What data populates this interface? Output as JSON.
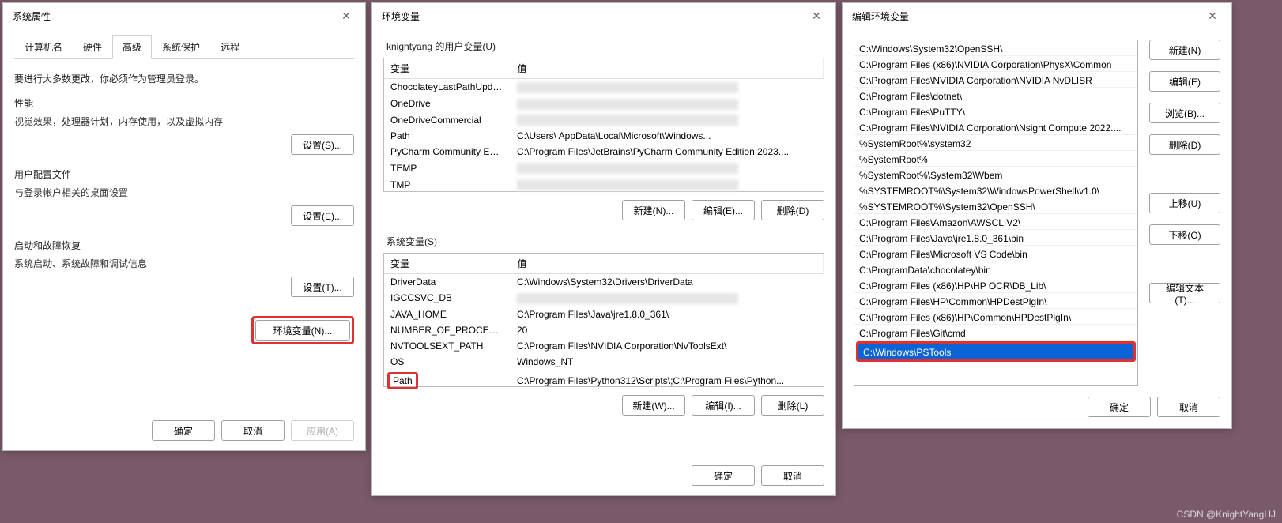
{
  "dlg1": {
    "title": "系统属性",
    "tabs": [
      "计算机名",
      "硬件",
      "高级",
      "系统保护",
      "远程"
    ],
    "activeTab": 2,
    "note": "要进行大多数更改，你必须作为管理员登录。",
    "groups": [
      {
        "title": "性能",
        "desc": "视觉效果，处理器计划，内存使用，以及虚拟内存",
        "btn": "设置(S)..."
      },
      {
        "title": "用户配置文件",
        "desc": "与登录帐户相关的桌面设置",
        "btn": "设置(E)..."
      },
      {
        "title": "启动和故障恢复",
        "desc": "系统启动、系统故障和调试信息",
        "btn": "设置(T)..."
      }
    ],
    "envBtn": "环境变量(N)...",
    "ok": "确定",
    "cancel": "取消",
    "apply": "应用(A)"
  },
  "dlg2": {
    "title": "环境变量",
    "userSection": "knightyang 的用户变量(U)",
    "sysSection": "系统变量(S)",
    "colVar": "变量",
    "colVal": "值",
    "userRows": [
      {
        "var": "ChocolateyLastPathUpdate",
        "val": "",
        "blur": true
      },
      {
        "var": "OneDrive",
        "val": "",
        "blur": true
      },
      {
        "var": "OneDriveCommercial",
        "val": "",
        "blur": true
      },
      {
        "var": "Path",
        "val": "C:\\Users\\                      AppData\\Local\\Microsoft\\Windows..."
      },
      {
        "var": "PyCharm Community Editi...",
        "val": "C:\\Program Files\\JetBrains\\PyCharm Community Edition 2023...."
      },
      {
        "var": "TEMP",
        "val": "",
        "blur": true
      },
      {
        "var": "TMP",
        "val": "",
        "blur": true
      }
    ],
    "sysRows": [
      {
        "var": "DriverData",
        "val": "C:\\Windows\\System32\\Drivers\\DriverData"
      },
      {
        "var": "IGCCSVC_DB",
        "val": "",
        "blur": true
      },
      {
        "var": "JAVA_HOME",
        "val": "C:\\Program Files\\Java\\jre1.8.0_361\\"
      },
      {
        "var": "NUMBER_OF_PROCESSORS",
        "val": "20"
      },
      {
        "var": "NVTOOLSEXT_PATH",
        "val": "C:\\Program Files\\NVIDIA Corporation\\NvToolsExt\\"
      },
      {
        "var": "OS",
        "val": "Windows_NT"
      },
      {
        "var": "Path",
        "val": "C:\\Program Files\\Python312\\Scripts\\;C:\\Program Files\\Python...",
        "hl": true
      }
    ],
    "newU": "新建(N)...",
    "editU": "编辑(E)...",
    "delU": "删除(D)",
    "newS": "新建(W)...",
    "editS": "编辑(I)...",
    "delS": "删除(L)",
    "ok": "确定",
    "cancel": "取消"
  },
  "dlg3": {
    "title": "编辑环境变量",
    "items": [
      "C:\\Windows\\System32\\OpenSSH\\",
      "C:\\Program Files (x86)\\NVIDIA Corporation\\PhysX\\Common",
      "C:\\Program Files\\NVIDIA Corporation\\NVIDIA NvDLISR",
      "C:\\Program Files\\dotnet\\",
      "C:\\Program Files\\PuTTY\\",
      "C:\\Program Files\\NVIDIA Corporation\\Nsight Compute 2022....",
      "%SystemRoot%\\system32",
      "%SystemRoot%",
      "%SystemRoot%\\System32\\Wbem",
      "%SYSTEMROOT%\\System32\\WindowsPowerShell\\v1.0\\",
      "%SYSTEMROOT%\\System32\\OpenSSH\\",
      "C:\\Program Files\\Amazon\\AWSCLIV2\\",
      "C:\\Program Files\\Java\\jre1.8.0_361\\bin",
      "C:\\Program Files\\Microsoft VS Code\\bin",
      "C:\\ProgramData\\chocolatey\\bin",
      "C:\\Program Files (x86)\\HP\\HP OCR\\DB_Lib\\",
      "C:\\Program Files\\HP\\Common\\HPDestPlgIn\\",
      "C:\\Program Files (x86)\\HP\\Common\\HPDestPlgIn\\",
      "C:\\Program Files\\Git\\cmd"
    ],
    "selected": "C:\\Windows\\PSTools",
    "btns": {
      "new": "新建(N)",
      "edit": "编辑(E)",
      "browse": "浏览(B)...",
      "delete": "删除(D)",
      "up": "上移(U)",
      "down": "下移(O)",
      "editText": "编辑文本(T)..."
    },
    "ok": "确定",
    "cancel": "取消"
  },
  "watermark": "CSDN @KnightYangHJ"
}
